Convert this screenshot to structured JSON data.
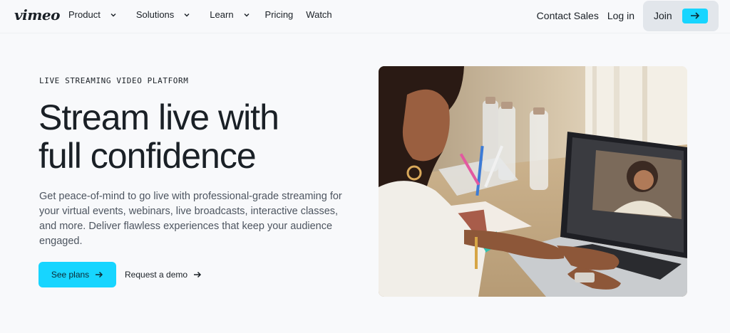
{
  "header": {
    "logo": "vimeo",
    "nav": [
      {
        "label": "Product",
        "has_menu": true
      },
      {
        "label": "Solutions",
        "has_menu": true
      },
      {
        "label": "Learn",
        "has_menu": true
      },
      {
        "label": "Pricing",
        "has_menu": false
      },
      {
        "label": "Watch",
        "has_menu": false
      }
    ],
    "contact_sales": "Contact Sales",
    "login": "Log in",
    "join": "Join"
  },
  "hero": {
    "eyebrow": "LIVE STREAMING VIDEO PLATFORM",
    "headline_line1": "Stream live with",
    "headline_line2": "full confidence",
    "description": "Get peace-of-mind to go live with professional-grade streaming for your virtual events, webinars, live broadcasts, interactive classes, and more. Deliver flawless experiences that keep your audience engaged.",
    "primary_cta": "See plans",
    "secondary_cta": "Request a demo"
  },
  "colors": {
    "accent": "#17d5ff",
    "text": "#1a2026",
    "muted_text": "#4d5560",
    "background": "#f8f9fb",
    "join_bg": "#e2e6eb"
  }
}
